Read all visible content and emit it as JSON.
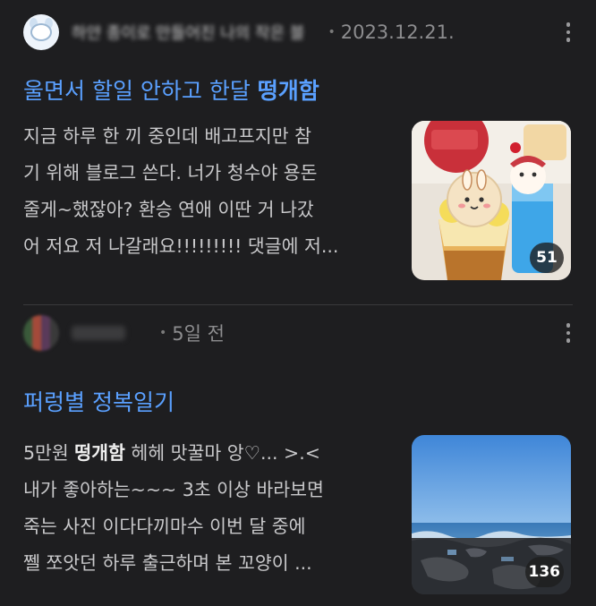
{
  "posts": [
    {
      "author": "하얀 종이로 만들어진 나의 작은 블",
      "date": "2023.12.21.",
      "title_plain": "울면서 할일 안하고 한달 ",
      "title_bold": "떵개함",
      "excerpt_lines": [
        "지금 하루 한 끼 중인데 배고프지만 참",
        "기 위해 블로그 쓴다. 너가 청수야 용돈",
        "줄게~했잖아? 환승 연애 이딴 거 나갔",
        "어 저요 저 나갈래요!!!!!!!!! 댓글에 저..."
      ],
      "image_count": "51"
    },
    {
      "date": "5일 전",
      "title": "퍼렁별 정복일기",
      "excerpt_line1_prefix": "5만원 ",
      "excerpt_line1_bold": "떵개함",
      "excerpt_line1_suffix": " 헤헤 맛꿀마 앙♡... >.<",
      "excerpt_lines": [
        "내가 좋아하는~~~ 3초 이상 바라보면",
        "죽는 사진 이다다끼마수 이번 달 중에",
        "쩰 쪼앗던 하루 출근하며 본 꼬양이 ..."
      ],
      "image_count": "136"
    }
  ],
  "separator": "•",
  "colors": {
    "background": "#1e1e20",
    "title_blue": "#5aa0ff",
    "text": "#c9c9cb",
    "muted": "#8d8d8f"
  },
  "icons": [
    "more-vertical-icon"
  ]
}
